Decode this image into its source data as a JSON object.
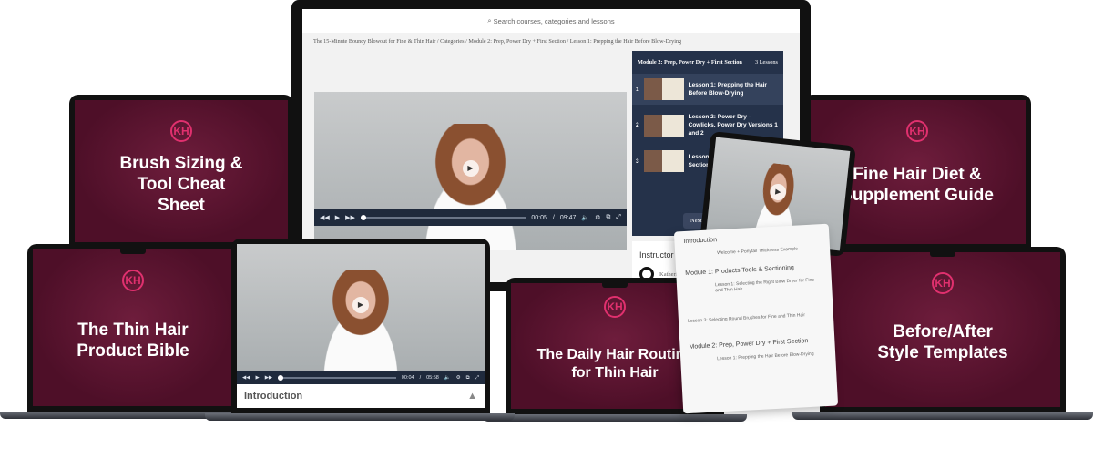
{
  "monitor": {
    "search_placeholder": "Search courses, categories and lessons",
    "breadcrumb": "The 15-Minute Bouncy Blowout for Fine & Thin Hair / Categories / Module 2: Prep, Power Dry + First Section / Lesson 1: Prepping the Hair Before Blow-Drying",
    "player": {
      "current": "00:05",
      "sep": "/",
      "duration": "09:47",
      "progress": 0.01
    },
    "module": {
      "title": "Module 2: Prep, Power Dry + First Section",
      "count": "3 Lessons",
      "lessons": [
        {
          "num": "1",
          "title": "Lesson 1: Prepping the Hair Before Blow-Drying"
        },
        {
          "num": "2",
          "title": "Lesson 2: Power Dry – Cowlicks, Power Dry Versions 1 and 2"
        },
        {
          "num": "3",
          "title": "Lesson 3: Sec... the Foundati... Sectioning a..."
        }
      ],
      "next_label": "Next C"
    },
    "instructor": {
      "heading": "Instructor",
      "name": "Katherine Ha"
    }
  },
  "laptops": {
    "back_left": "Brush Sizing & Tool Cheat Sheet",
    "back_right": "Fine Hair Diet & Supplement Guide",
    "front_left": "The Thin Hair Product Bible",
    "front_center": "The Daily Hair Routine for Thin Hair",
    "front_right": "Before/After Style Templates",
    "logo": "KH"
  },
  "front_video": {
    "current": "00:04",
    "sep": "/",
    "duration": "05:58",
    "section": "Introduction",
    "progress": 0.01
  },
  "scroll": {
    "items": [
      "Introduction",
      "Welcome + Ponytail Thickness Example",
      "Module 1: Products Tools & Sectioning",
      "Lesson 1: Selecting the Right Blow Dryer for Fine and Thin Hair",
      "Lesson 3: Selecting Round Brushes for Fine and Thin Hair",
      "Module 2: Prep, Power Dry + First Section",
      "Lesson 1: Prepping the Hair Before Blow-Drying"
    ]
  }
}
